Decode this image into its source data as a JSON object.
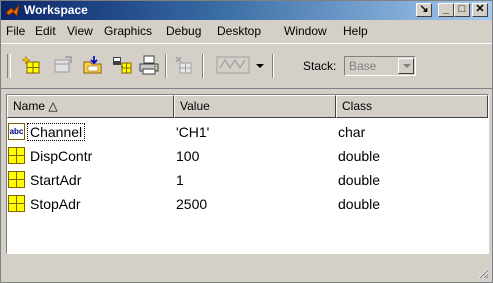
{
  "window": {
    "title": "Workspace"
  },
  "title_buttons": {
    "dock": "↘",
    "minimize": "_",
    "maximize": "□",
    "close": "✕"
  },
  "menu": [
    "File",
    "Edit",
    "View",
    "Graphics",
    "Debug",
    "Desktop",
    "Window",
    "Help"
  ],
  "toolbar": {
    "icons": [
      "new-variable-icon",
      "open-selection-icon",
      "import-data-icon",
      "save-icon",
      "print-icon",
      "delete-icon",
      "plot-selection-icon",
      "plot-dropdown-icon"
    ],
    "stack_label": "Stack:",
    "stack_value": "Base"
  },
  "table": {
    "columns": [
      "Name △",
      "Value",
      "Class"
    ],
    "rows": [
      {
        "icon": "char-icon",
        "icon_text": "abc",
        "name": "Channel",
        "value": "'CH1'",
        "class": "char"
      },
      {
        "icon": "matrix-icon",
        "name": "DispContr",
        "value": "100",
        "class": "double"
      },
      {
        "icon": "matrix-icon",
        "name": "StartAdr",
        "value": "1",
        "class": "double"
      },
      {
        "icon": "matrix-icon",
        "name": "StopAdr",
        "value": "2500",
        "class": "double"
      }
    ]
  },
  "colors": {
    "titlebar_start": "#0a246a",
    "titlebar_end": "#a6caf0",
    "chrome": "#d4d0c8",
    "matrix_icon": "#ffff00"
  }
}
